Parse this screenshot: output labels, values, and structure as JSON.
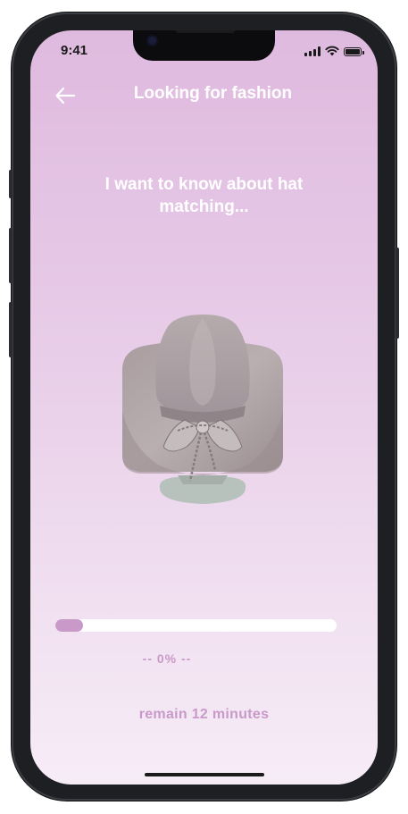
{
  "status_bar": {
    "time": "9:41"
  },
  "header": {
    "back_icon": "arrow-left-icon",
    "title": "Looking for fashion"
  },
  "main": {
    "question": "I want to know about hat matching...",
    "product_image": "cowboy-hat"
  },
  "progress": {
    "value": 0,
    "label": "-- 0% --"
  },
  "footer": {
    "remain_text": "remain 12 minutes"
  },
  "colors": {
    "accent": "#c99ac9",
    "background_top": "#dfbadf",
    "background_bottom": "#f6ecf6",
    "text_light": "#ffffff"
  }
}
